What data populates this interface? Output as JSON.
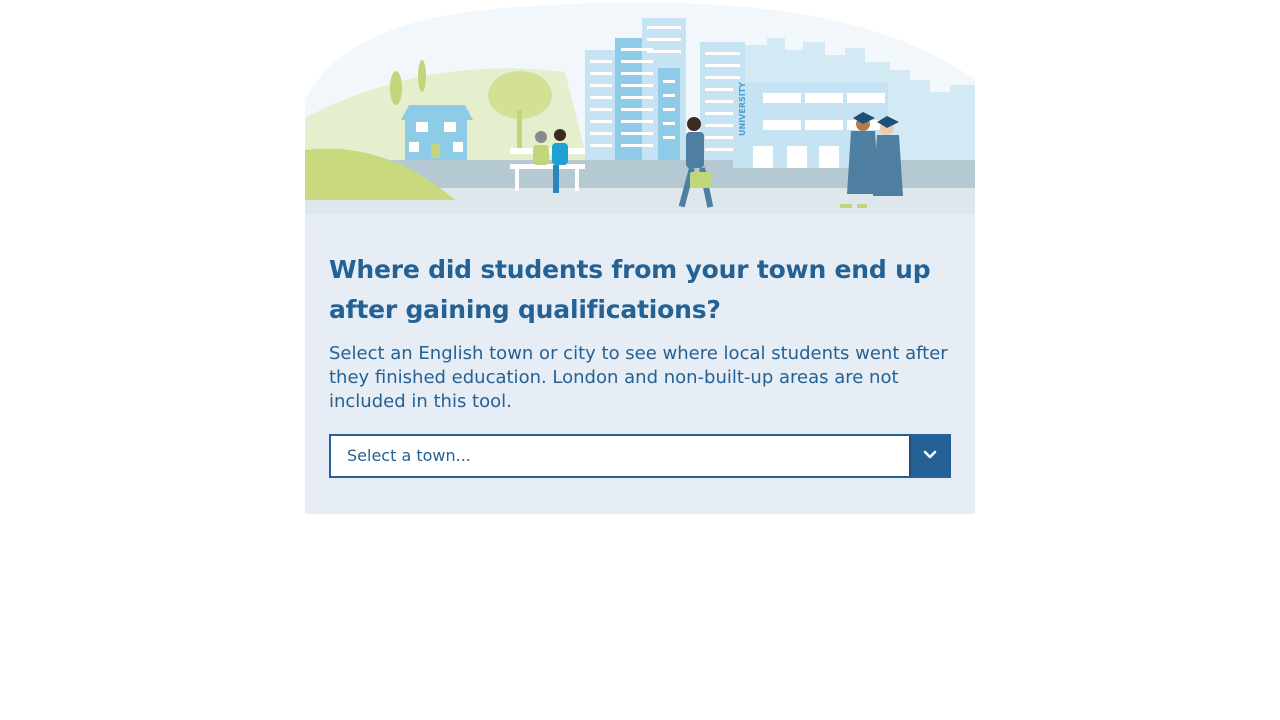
{
  "tool": {
    "title": "Where did students from your town end up after gaining qualifications?",
    "description": "Select an English town or city to see where local students went after they finished education. London and non-built-up areas are not included in this tool.",
    "town_select": {
      "placeholder": "Select a town..."
    }
  },
  "hero": {
    "building_sign": "UNIVERSITY"
  },
  "colors": {
    "primary": "#246194",
    "panel_background": "#e6edf4",
    "hill_green": "#c9d97e",
    "building_blue": "#8ecbe6"
  },
  "icons": {
    "dropdown": "chevron-down-icon"
  }
}
